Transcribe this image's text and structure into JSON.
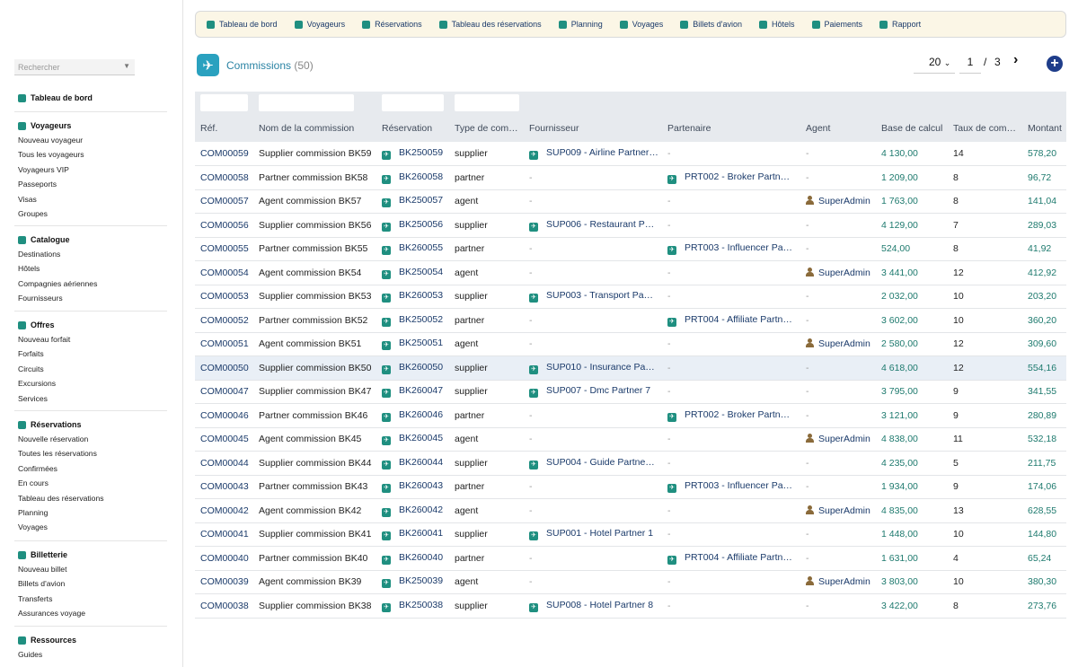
{
  "sidebar": {
    "search_placeholder": "Rechercher",
    "dashboard": "Tableau de bord",
    "sections": [
      {
        "title": "Voyageurs",
        "items": [
          "Nouveau voyageur",
          "Tous les voyageurs",
          "Voyageurs VIP",
          "Passeports",
          "Visas",
          "Groupes"
        ]
      },
      {
        "title": "Catalogue",
        "items": [
          "Destinations",
          "Hôtels",
          "Compagnies aériennes",
          "Fournisseurs"
        ]
      },
      {
        "title": "Offres",
        "items": [
          "Nouveau forfait",
          "Forfaits",
          "Circuits",
          "Excursions",
          "Services"
        ]
      },
      {
        "title": "Réservations",
        "items": [
          "Nouvelle réservation",
          "Toutes les réservations",
          "Confirmées",
          "En cours",
          "Tableau des réservations",
          "Planning",
          "Voyages"
        ]
      },
      {
        "title": "Billetterie",
        "items": [
          "Nouveau billet",
          "Billets d'avion",
          "Transferts",
          "Assurances voyage"
        ]
      },
      {
        "title": "Ressources",
        "items": [
          "Guides"
        ]
      }
    ]
  },
  "topnav": [
    "Tableau de bord",
    "Voyageurs",
    "Réservations",
    "Tableau des réservations",
    "Planning",
    "Voyages",
    "Billets d'avion",
    "Hôtels",
    "Paiements",
    "Rapport"
  ],
  "page": {
    "title": "Commissions",
    "count": "(50)"
  },
  "pager": {
    "per_page": "20",
    "current": "1",
    "sep": "/",
    "total": "3",
    "next": "›",
    "add": "+"
  },
  "columns": [
    "Réf.",
    "Nom de la commission",
    "Réservation",
    "Type de com…",
    "Fournisseur",
    "Partenaire",
    "Agent",
    "Base de calcul",
    "Taux de com…",
    "Montant"
  ],
  "rows": [
    {
      "ref": "COM00059",
      "name": "Supplier commission BK59",
      "resa": "BK250059",
      "type": "supplier",
      "fourn": "SUP009 - Airline Partner…",
      "part": "-",
      "agent": "-",
      "base": "4 130,00",
      "taux": "14",
      "montant": "578,20"
    },
    {
      "ref": "COM00058",
      "name": "Partner commission BK58",
      "resa": "BK260058",
      "type": "partner",
      "fourn": "-",
      "part": "PRT002 - Broker Partn…",
      "agent": "-",
      "base": "1 209,00",
      "taux": "8",
      "montant": "96,72"
    },
    {
      "ref": "COM00057",
      "name": "Agent commission BK57",
      "resa": "BK250057",
      "type": "agent",
      "fourn": "-",
      "part": "-",
      "agent": "SuperAdmin",
      "base": "1 763,00",
      "taux": "8",
      "montant": "141,04"
    },
    {
      "ref": "COM00056",
      "name": "Supplier commission BK56",
      "resa": "BK250056",
      "type": "supplier",
      "fourn": "SUP006 - Restaurant P…",
      "part": "-",
      "agent": "-",
      "base": "4 129,00",
      "taux": "7",
      "montant": "289,03"
    },
    {
      "ref": "COM00055",
      "name": "Partner commission BK55",
      "resa": "BK260055",
      "type": "partner",
      "fourn": "-",
      "part": "PRT003 - Influencer Pa…",
      "agent": "-",
      "base": "524,00",
      "taux": "8",
      "montant": "41,92"
    },
    {
      "ref": "COM00054",
      "name": "Agent commission BK54",
      "resa": "BK250054",
      "type": "agent",
      "fourn": "-",
      "part": "-",
      "agent": "SuperAdmin",
      "base": "3 441,00",
      "taux": "12",
      "montant": "412,92"
    },
    {
      "ref": "COM00053",
      "name": "Supplier commission BK53",
      "resa": "BK260053",
      "type": "supplier",
      "fourn": "SUP003 - Transport Pa…",
      "part": "-",
      "agent": "-",
      "base": "2 032,00",
      "taux": "10",
      "montant": "203,20"
    },
    {
      "ref": "COM00052",
      "name": "Partner commission BK52",
      "resa": "BK250052",
      "type": "partner",
      "fourn": "-",
      "part": "PRT004 - Affiliate Partn…",
      "agent": "-",
      "base": "3 602,00",
      "taux": "10",
      "montant": "360,20"
    },
    {
      "ref": "COM00051",
      "name": "Agent commission BK51",
      "resa": "BK250051",
      "type": "agent",
      "fourn": "-",
      "part": "-",
      "agent": "SuperAdmin",
      "base": "2 580,00",
      "taux": "12",
      "montant": "309,60"
    },
    {
      "ref": "COM00050",
      "name": "Supplier commission BK50",
      "resa": "BK260050",
      "type": "supplier",
      "fourn": "SUP010 - Insurance Pa…",
      "part": "-",
      "agent": "-",
      "base": "4 618,00",
      "taux": "12",
      "montant": "554,16"
    },
    {
      "ref": "COM00047",
      "name": "Supplier commission BK47",
      "resa": "BK260047",
      "type": "supplier",
      "fourn": "SUP007 - Dmc Partner 7",
      "part": "-",
      "agent": "-",
      "base": "3 795,00",
      "taux": "9",
      "montant": "341,55"
    },
    {
      "ref": "COM00046",
      "name": "Partner commission BK46",
      "resa": "BK260046",
      "type": "partner",
      "fourn": "-",
      "part": "PRT002 - Broker Partn…",
      "agent": "-",
      "base": "3 121,00",
      "taux": "9",
      "montant": "280,89"
    },
    {
      "ref": "COM00045",
      "name": "Agent commission BK45",
      "resa": "BK260045",
      "type": "agent",
      "fourn": "-",
      "part": "-",
      "agent": "SuperAdmin",
      "base": "4 838,00",
      "taux": "11",
      "montant": "532,18"
    },
    {
      "ref": "COM00044",
      "name": "Supplier commission BK44",
      "resa": "BK260044",
      "type": "supplier",
      "fourn": "SUP004 - Guide Partne…",
      "part": "-",
      "agent": "-",
      "base": "4 235,00",
      "taux": "5",
      "montant": "211,75"
    },
    {
      "ref": "COM00043",
      "name": "Partner commission BK43",
      "resa": "BK260043",
      "type": "partner",
      "fourn": "-",
      "part": "PRT003 - Influencer Pa…",
      "agent": "-",
      "base": "1 934,00",
      "taux": "9",
      "montant": "174,06"
    },
    {
      "ref": "COM00042",
      "name": "Agent commission BK42",
      "resa": "BK260042",
      "type": "agent",
      "fourn": "-",
      "part": "-",
      "agent": "SuperAdmin",
      "base": "4 835,00",
      "taux": "13",
      "montant": "628,55"
    },
    {
      "ref": "COM00041",
      "name": "Supplier commission BK41",
      "resa": "BK260041",
      "type": "supplier",
      "fourn": "SUP001 - Hotel Partner 1",
      "part": "-",
      "agent": "-",
      "base": "1 448,00",
      "taux": "10",
      "montant": "144,80"
    },
    {
      "ref": "COM00040",
      "name": "Partner commission BK40",
      "resa": "BK260040",
      "type": "partner",
      "fourn": "-",
      "part": "PRT004 - Affiliate Partn…",
      "agent": "-",
      "base": "1 631,00",
      "taux": "4",
      "montant": "65,24"
    },
    {
      "ref": "COM00039",
      "name": "Agent commission BK39",
      "resa": "BK250039",
      "type": "agent",
      "fourn": "-",
      "part": "-",
      "agent": "SuperAdmin",
      "base": "3 803,00",
      "taux": "10",
      "montant": "380,30"
    },
    {
      "ref": "COM00038",
      "name": "Supplier commission BK38",
      "resa": "BK250038",
      "type": "supplier",
      "fourn": "SUP008 - Hotel Partner 8",
      "part": "-",
      "agent": "-",
      "base": "3 422,00",
      "taux": "8",
      "montant": "273,76"
    }
  ],
  "highlight_row": 9,
  "colors": {
    "accent": "#1f8f80",
    "link": "#1a3a6a",
    "title": "#2a83a4",
    "add": "#1f3d8a"
  }
}
